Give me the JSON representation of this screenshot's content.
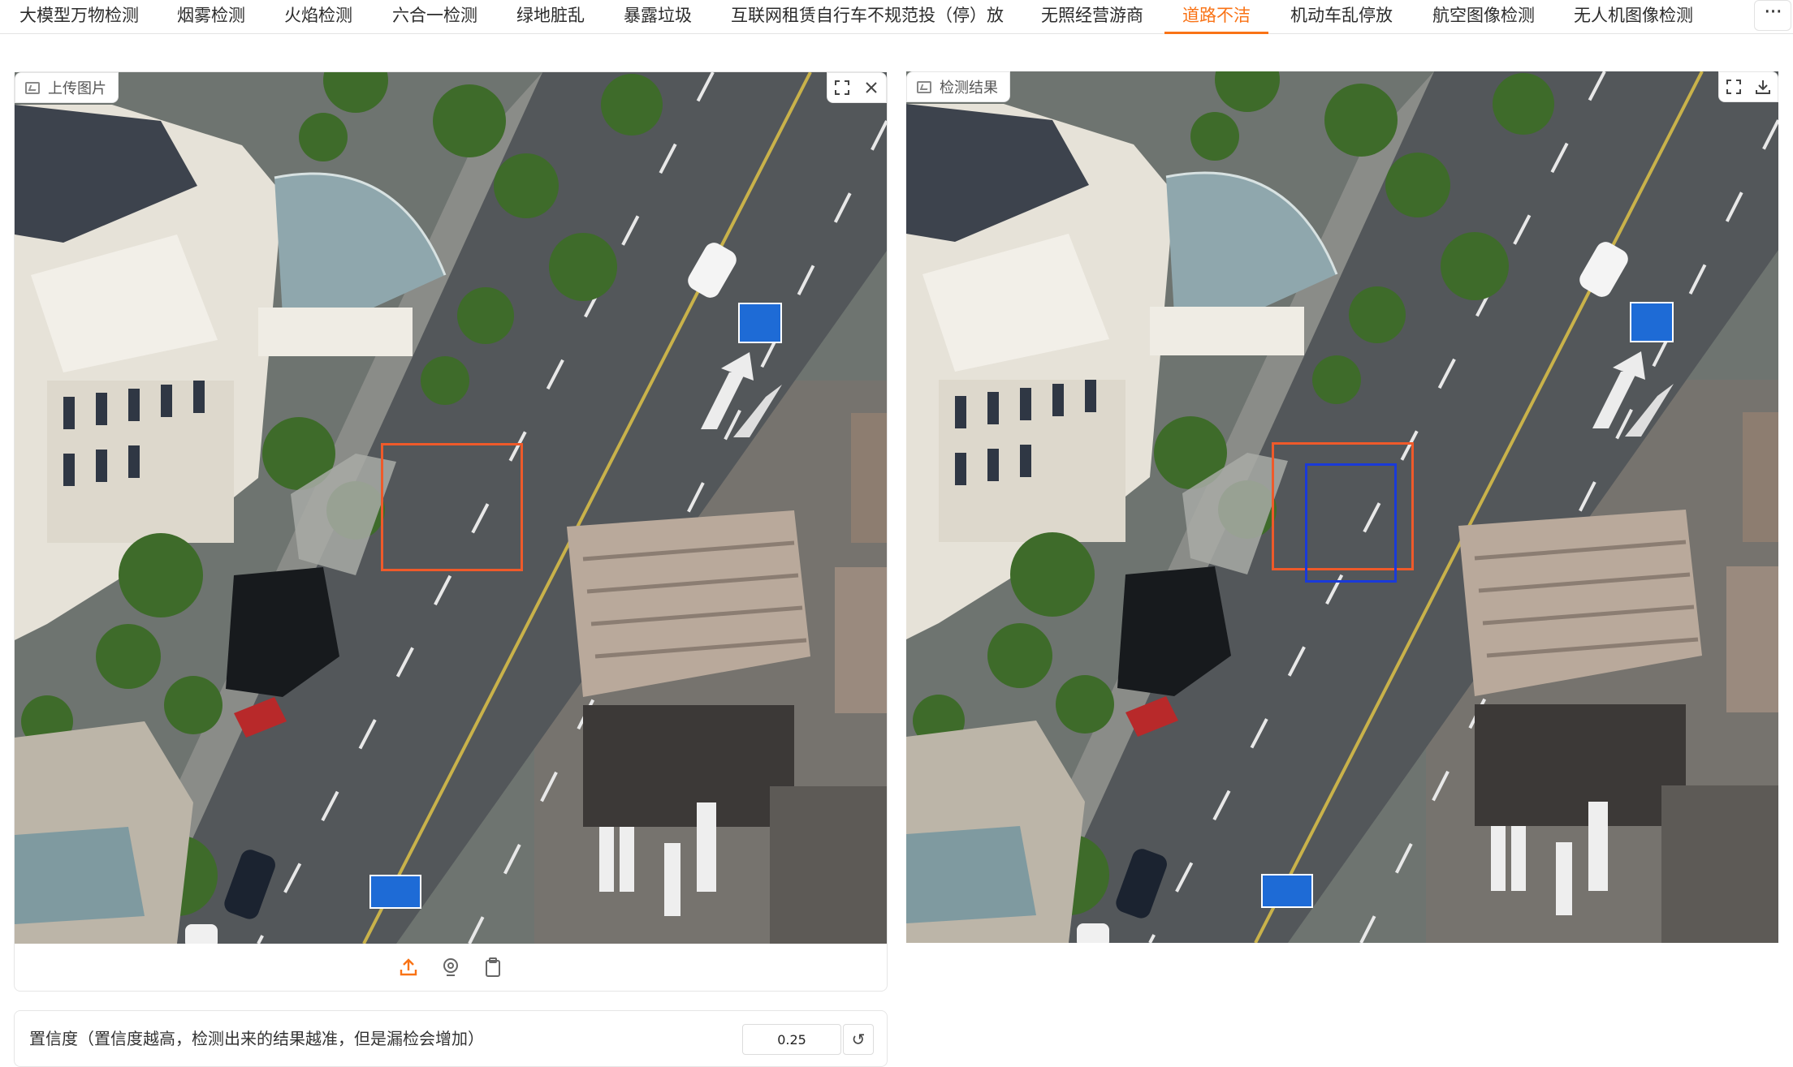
{
  "tabs": [
    {
      "label": "大模型万物检测"
    },
    {
      "label": "烟雾检测"
    },
    {
      "label": "火焰检测"
    },
    {
      "label": "六合一检测"
    },
    {
      "label": "绿地脏乱"
    },
    {
      "label": "暴露垃圾"
    },
    {
      "label": "互联网租赁自行车不规范投（停）放"
    },
    {
      "label": "无照经营游商"
    },
    {
      "label": "道路不洁"
    },
    {
      "label": "机动车乱停放"
    },
    {
      "label": "航空图像检测"
    },
    {
      "label": "无人机图像检测"
    }
  ],
  "active_tab": "道路不洁",
  "accent_color": "#f97316",
  "more_button": "···",
  "upload_panel": {
    "label": "上传图片",
    "actions": {
      "fullscreen_icon": "expand-icon",
      "close_icon": "close-icon"
    },
    "tools": [
      "upload-icon",
      "webcam-icon",
      "clipboard-icon"
    ]
  },
  "result_panel": {
    "label": "检测结果",
    "actions": {
      "fullscreen_icon": "expand-icon",
      "download_icon": "download-icon"
    }
  },
  "detection_colors": {
    "input_box": "#ef5a2a",
    "result_box": "#1a3ad8"
  },
  "confidence": {
    "label": "置信度（置信度越高，检测出来的结果越准，但是漏检会增加）",
    "value": "0.25",
    "reset_icon": "reset-icon"
  }
}
